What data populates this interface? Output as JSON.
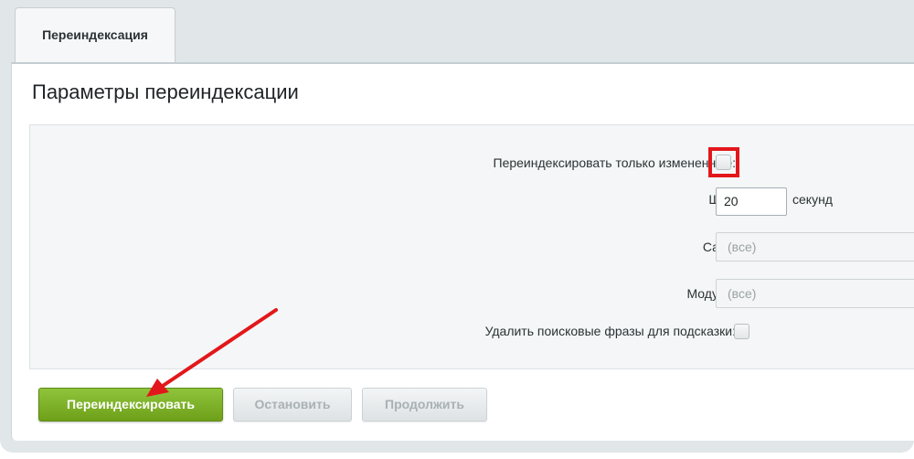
{
  "tabs": [
    {
      "label": "Переиндексация",
      "active": true
    }
  ],
  "page_title": "Параметры переиндексации",
  "form": {
    "only_changed": {
      "label": "Переиндексировать только измененные:",
      "checked": false
    },
    "step": {
      "label": "Шаг:",
      "value": "20",
      "unit": "секунд"
    },
    "site": {
      "label": "Сайт:",
      "selected": "(все)"
    },
    "module": {
      "label": "Модуль:",
      "selected": "(все)"
    },
    "delete_phrases": {
      "label": "Удалить поисковые фразы для подсказки:",
      "checked": false
    }
  },
  "buttons": {
    "reindex": "Переиндексировать",
    "stop": "Остановить",
    "continue": "Продолжить"
  },
  "colors": {
    "highlight": "#e3171b",
    "primary_button": "#7cb22a"
  }
}
